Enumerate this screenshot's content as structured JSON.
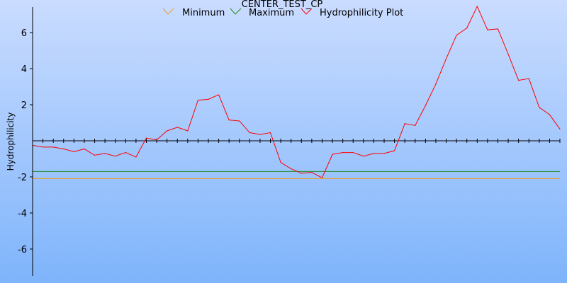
{
  "chart_data": {
    "type": "line",
    "title": "CENTER_TEST_CP",
    "xlabel": "",
    "ylabel": "Hydrophilicity",
    "ylim": [
      -7.5,
      7.5
    ],
    "yticks": [
      -6,
      -4,
      -2,
      2,
      4,
      6
    ],
    "ytick_labels": [
      "-6",
      "-4",
      "-2",
      "2",
      "4",
      "6"
    ],
    "legend_position": "top-center",
    "grid": false,
    "baseline": 0,
    "minimum": {
      "name": "Minimum",
      "value": -2.1,
      "color": "#e8a030"
    },
    "maximum": {
      "name": "Maximum",
      "value": -1.7,
      "color": "#228b22"
    },
    "series": [
      {
        "name": "Hydrophilicity Plot",
        "color": "#ff0000",
        "values": [
          -0.25,
          -0.35,
          -0.35,
          -0.45,
          -0.6,
          -0.45,
          -0.8,
          -0.7,
          -0.85,
          -0.65,
          -0.9,
          0.15,
          0.05,
          0.55,
          0.75,
          0.55,
          2.25,
          2.3,
          2.55,
          1.15,
          1.1,
          0.45,
          0.35,
          0.45,
          -1.2,
          -1.55,
          -1.8,
          -1.75,
          -2.05,
          -0.75,
          -0.65,
          -0.65,
          -0.85,
          -0.7,
          -0.7,
          -0.55,
          0.95,
          0.85,
          1.95,
          3.15,
          4.55,
          5.85,
          6.25,
          7.45,
          6.15,
          6.2,
          4.8,
          3.35,
          3.45,
          1.85,
          1.45,
          0.65
        ]
      }
    ]
  }
}
